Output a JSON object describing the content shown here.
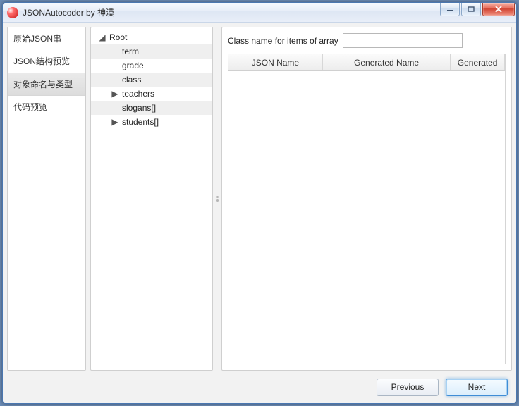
{
  "title": "JSONAutocoder by 神漠",
  "sidebar": {
    "items": [
      {
        "label": "原始JSON串"
      },
      {
        "label": "JSON结构预览"
      },
      {
        "label": "对象命名与类型"
      },
      {
        "label": "代码预览"
      }
    ],
    "selected_index": 2
  },
  "tree": {
    "root_label": "Root",
    "children": [
      {
        "label": "term",
        "expandable": false
      },
      {
        "label": "grade",
        "expandable": false
      },
      {
        "label": "class",
        "expandable": false
      },
      {
        "label": "teachers",
        "expandable": true
      },
      {
        "label": "slogans[]",
        "expandable": false
      },
      {
        "label": "students[]",
        "expandable": true
      }
    ]
  },
  "form": {
    "class_name_label": "Class name for items of array",
    "class_name_value": ""
  },
  "table": {
    "columns": [
      {
        "label": "JSON Name",
        "width": 140
      },
      {
        "label": "Generated Name",
        "width": 190
      },
      {
        "label": "Generated",
        "width": 80
      }
    ],
    "rows": []
  },
  "buttons": {
    "previous": "Previous",
    "next": "Next"
  }
}
